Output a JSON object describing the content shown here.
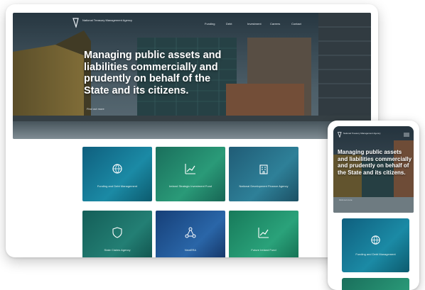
{
  "site": {
    "logo_text": "National Treasury Management Agency",
    "menu": [
      "Funding",
      "Debt",
      "Investment",
      "Careers",
      "Contact"
    ],
    "headline_desktop": "Managing public assets and liabilities commercially and prudently on behalf of the State and its citizens.",
    "headline_mobile": "Managing public assets and liabilities commercially and prudently on behalf of the State and its citizens.",
    "hero_link": "Find out more"
  },
  "tiles": [
    {
      "label": "Funding and Debt Management",
      "icon": "globe-arrows-icon",
      "color": "#0e6d8c"
    },
    {
      "label": "Ireland Strategic Investment Fund",
      "icon": "growth-chart-icon",
      "color": "#1f7c63"
    },
    {
      "label": "National Development Finance Agency",
      "icon": "building-icon",
      "color": "#2a6d86"
    },
    {
      "label": "State Claims Agency",
      "icon": "shield-icon",
      "color": "#1c6a61"
    },
    {
      "label": "NewERA",
      "icon": "network-icon",
      "color": "#1e4e8a"
    },
    {
      "label": "Future Ireland Fund",
      "icon": "growth-chart-icon",
      "color": "#1f8a66"
    }
  ],
  "mobile_tile": {
    "label": "Funding and Debt Management",
    "icon": "globe-arrows-icon"
  },
  "colors": {
    "hero_sky": "#3f5563",
    "building_green": "#2f6b66",
    "water": "#8a98a0"
  }
}
